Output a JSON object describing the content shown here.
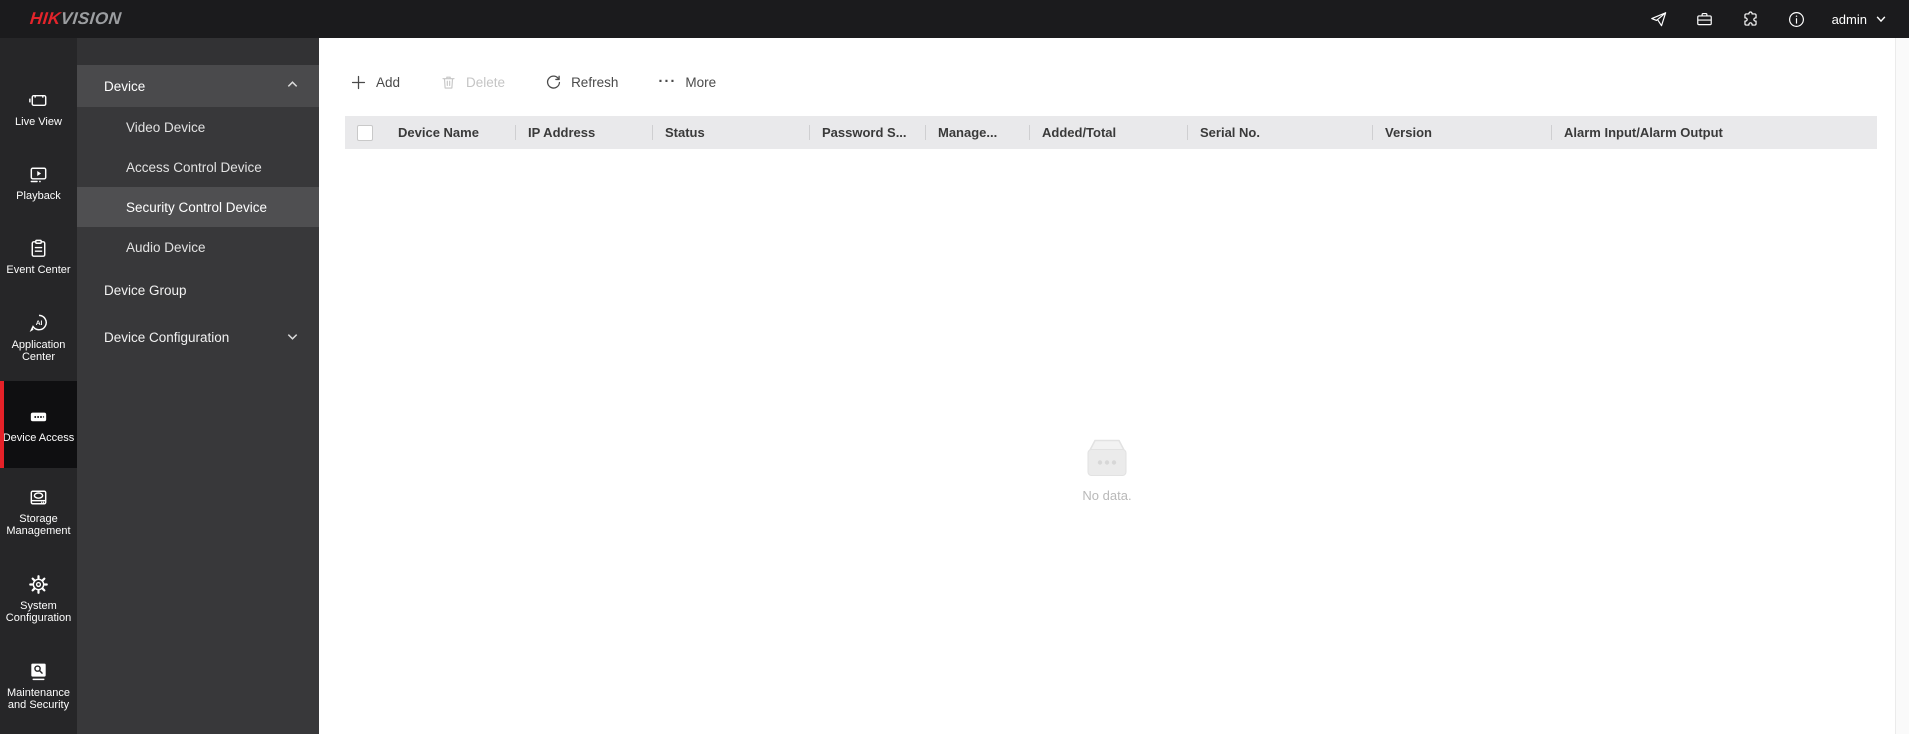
{
  "topbar": {
    "logo_hik": "HIK",
    "logo_vision": "VISION",
    "user": "admin",
    "icons": [
      "send-icon",
      "toolbox-icon",
      "puzzle-icon",
      "info-icon",
      "chevron-down-icon"
    ]
  },
  "rail": {
    "items": [
      {
        "label": "Live View",
        "icon": "live-view-icon",
        "selected": false
      },
      {
        "label": "Playback",
        "icon": "playback-icon",
        "selected": false
      },
      {
        "label": "Event Center",
        "icon": "event-center-icon",
        "selected": false
      },
      {
        "label": "Application Center",
        "icon": "application-center-icon",
        "selected": false
      },
      {
        "label": "Device Access",
        "icon": "device-access-icon",
        "selected": true
      },
      {
        "label": "Storage Management",
        "icon": "storage-management-icon",
        "selected": false
      },
      {
        "label": "System Configuration",
        "icon": "system-configuration-icon",
        "selected": false
      },
      {
        "label": "Maintenance and Security",
        "icon": "maintenance-security-icon",
        "selected": false
      }
    ]
  },
  "subnav": {
    "device_section": {
      "label": "Device",
      "expanded": true,
      "items": [
        {
          "label": "Video Device",
          "selected": false
        },
        {
          "label": "Access Control Device",
          "selected": false
        },
        {
          "label": "Security Control Device",
          "selected": true
        },
        {
          "label": "Audio Device",
          "selected": false
        }
      ]
    },
    "device_group": {
      "label": "Device Group"
    },
    "device_configuration": {
      "label": "Device Configuration",
      "expanded": false
    }
  },
  "toolbar": {
    "add_label": "Add",
    "delete_label": "Delete",
    "delete_enabled": false,
    "refresh_label": "Refresh",
    "more_label": "More"
  },
  "table": {
    "columns": [
      "Device Name",
      "IP Address",
      "Status",
      "Password S...",
      "Manage...",
      "Added/Total",
      "Serial No.",
      "Version",
      "Alarm Input/Alarm Output"
    ],
    "rows": []
  },
  "empty_state": {
    "text": "No data."
  },
  "colors": {
    "accent_red": "#e62128",
    "topbar_bg": "#1b1b1d",
    "rail_bg": "#262628",
    "subnav_bg": "#38383a",
    "header_row_bg": "#e9e9eb"
  }
}
